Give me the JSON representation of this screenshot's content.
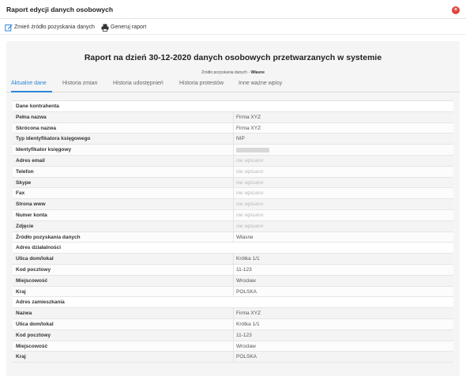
{
  "window": {
    "title": "Raport edycji danych osobowych",
    "close_icon": "close-icon"
  },
  "toolbar": {
    "change_source_label": "Zmień źródło pozyskania danych",
    "generate_report_label": "Generuj raport"
  },
  "report": {
    "title": "Raport na dzień 30-12-2020 danych osobowych przetwarzanych w systemie",
    "source_label": "Źródło pozyskania danych -",
    "source_value": "Własne"
  },
  "tabs": [
    {
      "label": "Aktualne dane",
      "active": true
    },
    {
      "label": "Historia zmian",
      "active": false
    },
    {
      "label": "Historia udostępnień",
      "active": false
    },
    {
      "label": "Historia protestów",
      "active": false
    },
    {
      "label": "Inne ważne wpisy",
      "active": false
    }
  ],
  "table": {
    "rows": [
      {
        "type": "section",
        "label": "Dane kontrahenta"
      },
      {
        "type": "field",
        "label": "Pełna nazwa",
        "value": "Firma XYZ"
      },
      {
        "type": "field",
        "label": "Skrócona nazwa",
        "value": "Firma XYZ"
      },
      {
        "type": "field",
        "label": "Typ identyfikatora księgowego",
        "value": "NIP"
      },
      {
        "type": "field",
        "label": "Identyfikator księgowy",
        "value": "",
        "redacted": true
      },
      {
        "type": "field",
        "label": "Adres email",
        "value": "nie wpisano",
        "empty": true
      },
      {
        "type": "field",
        "label": "Telefon",
        "value": "nie wpisano",
        "empty": true
      },
      {
        "type": "field",
        "label": "Skype",
        "value": "nie wpisano",
        "empty": true
      },
      {
        "type": "field",
        "label": "Fax",
        "value": "nie wpisano",
        "empty": true
      },
      {
        "type": "field",
        "label": "Strona www",
        "value": "nie wpisano",
        "empty": true
      },
      {
        "type": "field",
        "label": "Numer konta",
        "value": "nie wpisano",
        "empty": true
      },
      {
        "type": "field",
        "label": "Zdjęcie",
        "value": "nie wpisano",
        "empty": true
      },
      {
        "type": "field",
        "label": "Źródło pozyskania danych",
        "value": "Własne"
      },
      {
        "type": "section",
        "label": "Adres działalności"
      },
      {
        "type": "field",
        "label": "Ulica dom/lokal",
        "value": "Krótka 1/1"
      },
      {
        "type": "field",
        "label": "Kod pocztowy",
        "value": "11-123"
      },
      {
        "type": "field",
        "label": "Miejscowość",
        "value": "Wrocław"
      },
      {
        "type": "field",
        "label": "Kraj",
        "value": "POLSKA"
      },
      {
        "type": "section",
        "label": "Adres zamieszkania"
      },
      {
        "type": "field",
        "label": "Nazwa",
        "value": "Firma XYZ"
      },
      {
        "type": "field",
        "label": "Ulica dom/lokal",
        "value": "Krótka 1/1"
      },
      {
        "type": "field",
        "label": "Kod pocztowy",
        "value": "11-123"
      },
      {
        "type": "field",
        "label": "Miejscowość",
        "value": "Wrocław"
      },
      {
        "type": "field",
        "label": "Kraj",
        "value": "POLSKA"
      }
    ]
  },
  "colors": {
    "accent": "#2e86d6",
    "close": "#e0443e"
  }
}
